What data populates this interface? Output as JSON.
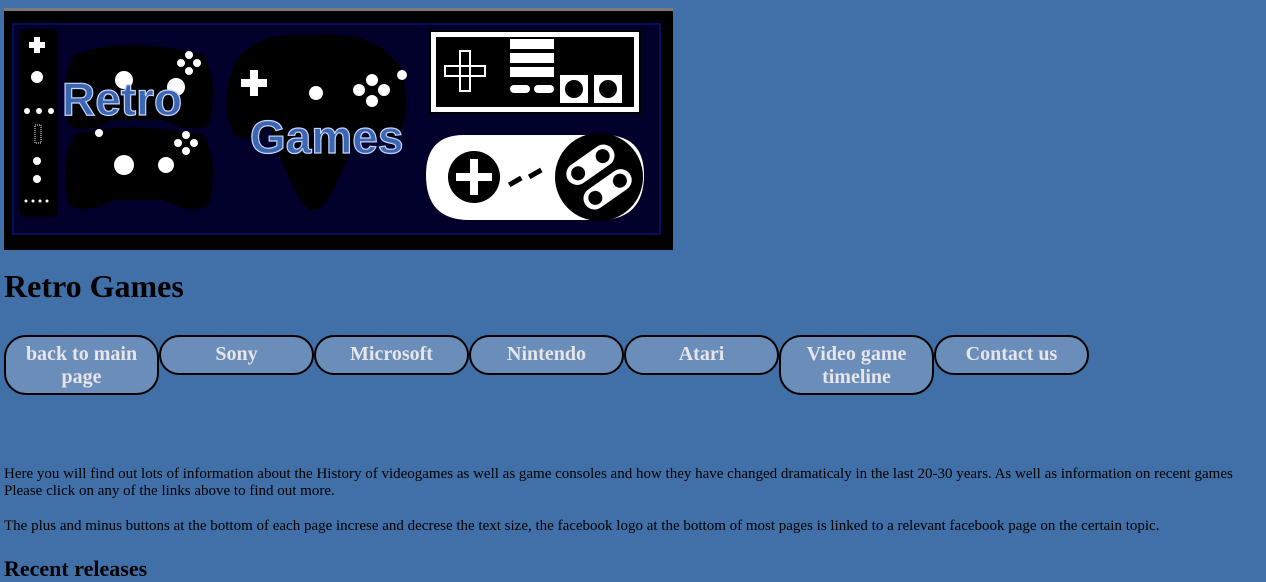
{
  "banner": {
    "logo_line1": "Retro",
    "logo_line2": "Games"
  },
  "header": {
    "title": "Retro Games"
  },
  "nav": {
    "items": [
      {
        "label": "back to main page"
      },
      {
        "label": "Sony"
      },
      {
        "label": "Microsoft"
      },
      {
        "label": "Nintendo"
      },
      {
        "label": "Atari"
      },
      {
        "label": "Video game timeline"
      },
      {
        "label": "Contact us"
      }
    ]
  },
  "content": {
    "intro": "Here you will find out lots of information about the History of videogames as well as game consoles and how they have changed dramaticaly in the last 20-30 years. As well as information on recent games Please click on any of the links above to find out more.",
    "note": "The plus and minus buttons at the bottom of each page increse and decrese the text size, the facebook logo at the bottom of most pages is linked to a relevant facebook page on the certain topic.",
    "recent_heading": "Recent releases"
  }
}
